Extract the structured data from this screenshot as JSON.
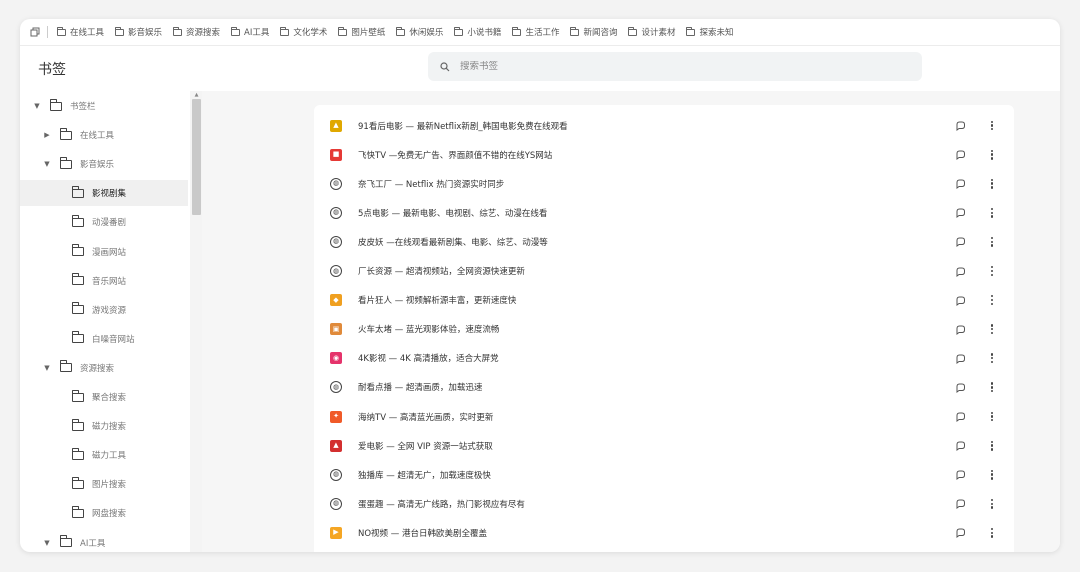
{
  "bookmarks_bar": {
    "items": [
      "在线工具",
      "影音娱乐",
      "资源搜索",
      "AI工具",
      "文化学术",
      "图片壁纸",
      "休闲娱乐",
      "小说书籍",
      "生活工作",
      "新闻咨询",
      "设计素材",
      "探索未知"
    ]
  },
  "header": {
    "title": "书签",
    "search_placeholder": "搜索书签"
  },
  "sidebar": {
    "items": [
      {
        "label": "书签栏",
        "level": 0,
        "expanded": true
      },
      {
        "label": "在线工具",
        "level": 1,
        "expanded": false
      },
      {
        "label": "影音娱乐",
        "level": 1,
        "expanded": true
      },
      {
        "label": "影视剧集",
        "level": 2,
        "selected": true
      },
      {
        "label": "动漫番剧",
        "level": 2
      },
      {
        "label": "漫画网站",
        "level": 2
      },
      {
        "label": "音乐网站",
        "level": 2
      },
      {
        "label": "游戏资源",
        "level": 2
      },
      {
        "label": "白噪音网站",
        "level": 2
      },
      {
        "label": "资源搜索",
        "level": 1,
        "expanded": true
      },
      {
        "label": "聚合搜索",
        "level": 2
      },
      {
        "label": "磁力搜索",
        "level": 2
      },
      {
        "label": "磁力工具",
        "level": 2
      },
      {
        "label": "图片搜索",
        "level": 2
      },
      {
        "label": "网盘搜索",
        "level": 2
      },
      {
        "label": "AI工具",
        "level": 1,
        "expanded": true
      }
    ]
  },
  "bookmarks": [
    {
      "title": "91看后电影 — 最新Netflix新剧_韩国电影免费在线观看",
      "icon": "yellow-logo-icon",
      "color": "#e0a800",
      "glyph": "▲"
    },
    {
      "title": "飞快TV —免费无广告、界面颜值不错的在线YS网站",
      "icon": "red-logo-icon",
      "color": "#e53935",
      "glyph": "■"
    },
    {
      "title": "奈飞工厂 — Netflix 热门资源实时同步",
      "icon": "globe-icon",
      "color": "",
      "glyph": "◍"
    },
    {
      "title": "5点电影 — 最新电影、电视剧、综艺、动漫在线看",
      "icon": "globe-icon",
      "color": "",
      "glyph": "◍"
    },
    {
      "title": "皮皮妖 —在线观看最新剧集、电影、综艺、动漫等",
      "icon": "globe-icon",
      "color": "",
      "glyph": "◍"
    },
    {
      "title": "厂长资源 — 超清视频站，全网资源快速更新",
      "icon": "globe-icon",
      "color": "",
      "glyph": "◍"
    },
    {
      "title": "看片狂人 — 视频解析源丰富，更新速度快",
      "icon": "orange-logo-icon",
      "color": "#f0a020",
      "glyph": "◆"
    },
    {
      "title": "火车太堵 — 蓝光观影体验，速度流畅",
      "icon": "tv-logo-icon",
      "color": "#e08a3a",
      "glyph": "▣"
    },
    {
      "title": "4K影视 — 4K 高清播放，适合大屏党",
      "icon": "pink-logo-icon",
      "color": "#e5336b",
      "glyph": "◉"
    },
    {
      "title": "耐看点播 — 超清画质，加载迅速",
      "icon": "globe-icon",
      "color": "",
      "glyph": "◍"
    },
    {
      "title": "海纳TV — 高清蓝光画质，实时更新",
      "icon": "flame-logo-icon",
      "color": "#f05a28",
      "glyph": "✦"
    },
    {
      "title": "爱电影 — 全网 VIP 资源一站式获取",
      "icon": "red-logo-icon",
      "color": "#d32f2f",
      "glyph": "▲"
    },
    {
      "title": "独播库 — 超清无广，加载速度极快",
      "icon": "globe-icon",
      "color": "",
      "glyph": "◍"
    },
    {
      "title": "蛋蛋趣 — 高清无广线路，热门影视应有尽有",
      "icon": "globe-icon",
      "color": "",
      "glyph": "◍"
    },
    {
      "title": "NO视频 — 港台日韩欧美剧全覆盖",
      "icon": "play-logo-icon",
      "color": "#f5a623",
      "glyph": "▶"
    }
  ]
}
